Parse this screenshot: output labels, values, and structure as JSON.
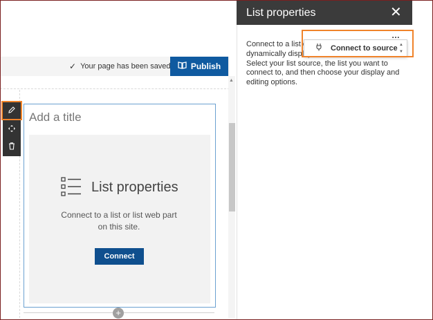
{
  "status": {
    "saved_text": "Your page has been saved",
    "publish_label": "Publish"
  },
  "toolbar": {
    "edit_icon": "pencil-icon",
    "move_icon": "move-icon",
    "delete_icon": "trash-icon"
  },
  "webpart": {
    "title_placeholder": "Add a title",
    "heading": "List properties",
    "description": "Connect to a list or list web part on this site.",
    "connect_label": "Connect"
  },
  "pane": {
    "title": "List properties",
    "body": "Connect to a list or list web part to dynamically display the list information. Select your list source, the list you want to connect to, and then choose your display and editing options.",
    "more_label": "…",
    "dropdown_label": "Connect to source"
  },
  "colors": {
    "publish": "#0f5aa0",
    "connect": "#0f4f8e",
    "highlight": "#f0832a",
    "pane_header": "#3b3b3b"
  }
}
